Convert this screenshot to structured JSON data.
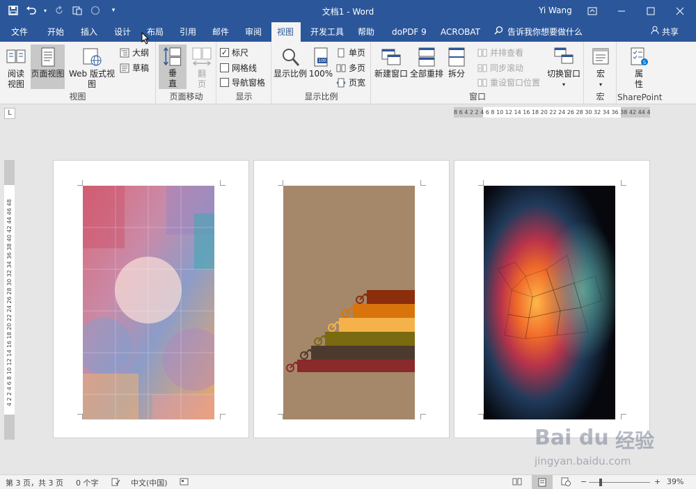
{
  "window": {
    "doc_title": "文档1 - Word",
    "user": "Yi Wang"
  },
  "tabs": [
    "文件",
    "开始",
    "插入",
    "设计",
    "布局",
    "引用",
    "邮件",
    "审阅",
    "视图",
    "开发工具",
    "帮助",
    "doPDF 9",
    "ACROBAT"
  ],
  "active_tab": "视图",
  "tell_me": "告诉我你想要做什么",
  "share": "共享",
  "ribbon": {
    "views": {
      "label": "视图",
      "read_mode": "阅读视图",
      "print_layout": "页面视图",
      "web_layout": "Web 版式视图",
      "outline": "大纲",
      "draft": "草稿"
    },
    "page_movement": {
      "label": "页面移动",
      "vertical": "垂直",
      "side_to_side": "翻页"
    },
    "show": {
      "label": "显示",
      "ruler": "标尺",
      "ruler_checked": true,
      "gridlines": "网格线",
      "gridlines_checked": false,
      "nav_pane": "导航窗格",
      "nav_pane_checked": false
    },
    "zoom": {
      "label": "显示比例",
      "zoom": "显示比例",
      "hundred": "100%",
      "one_page": "单页",
      "multiple_pages": "多页",
      "page_width": "页宽"
    },
    "window": {
      "label": "窗口",
      "new_window": "新建窗口",
      "arrange_all": "全部重排",
      "split": "拆分",
      "side_by_side": "并排查看",
      "sync_scroll": "同步滚动",
      "reset_position": "重设窗口位置",
      "switch_windows": "切换窗口"
    },
    "macros": {
      "label": "宏",
      "macros": "宏"
    },
    "sharepoint": {
      "label": "SharePoint",
      "properties": "属性"
    }
  },
  "ruler": {
    "horizontal_text": "8 6 4 2   2  4  6  8 10 12 14 16 18 20 22 24 26 28 30 32 34 36 38   42 44 46",
    "vertical_text": "4 2  2 4 6 8 10 12 14 16 18 20 22 24 26 28 30 32 34 36 38 40 42 44 46 48",
    "tab_stop": "L"
  },
  "status": {
    "page": "第 3 页，共 3 页",
    "words": "0 个字",
    "language": "中文(中国)",
    "zoom": "39%"
  },
  "watermark": {
    "logo": "Bai du",
    "cn": "经验",
    "url": "jingyan.baidu.com"
  },
  "colors": {
    "accent": "#2b579a",
    "ribbon_bg": "#f3f3f3",
    "canvas_bg": "#e6e6e6"
  }
}
